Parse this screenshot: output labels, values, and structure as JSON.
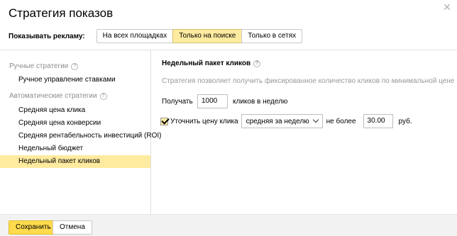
{
  "dialog": {
    "title": "Стратегия показов",
    "close_icon": "close-icon"
  },
  "show_ads": {
    "label": "Показывать рекламу:",
    "options": [
      "На всех площадках",
      "Только на поиске",
      "Только в сетях"
    ],
    "selected": "Только на поиске"
  },
  "sidebar": {
    "manual_group": "Ручные стратегии",
    "manual_items": [
      "Ручное управление ставками"
    ],
    "auto_group": "Автоматические стратегии",
    "auto_items": [
      "Средняя цена клика",
      "Средняя цена конверсии",
      "Средняя рентабельность инвестиций (ROI)",
      "Недельный бюджет",
      "Недельный пакет кликов"
    ],
    "selected": "Недельный пакет кликов"
  },
  "main": {
    "section_title": "Недельный пакет кликов",
    "description": "Стратегия позволяет получить фиксированное количество кликов по минимальной цене",
    "get_label": "Получать",
    "clicks_value": "1000",
    "clicks_suffix": "кликов в неделю",
    "refine_label": "Уточнить цену клика",
    "refine_checked": true,
    "price_mode": "средняя за неделю",
    "max_label": "не более",
    "max_value": "30.00",
    "currency": "руб."
  },
  "footer": {
    "save_label": "Сохранить",
    "cancel_label": "Отмена"
  },
  "colors": {
    "accent_selected": "#ffeba0",
    "save_button": "#ffdb4d"
  }
}
